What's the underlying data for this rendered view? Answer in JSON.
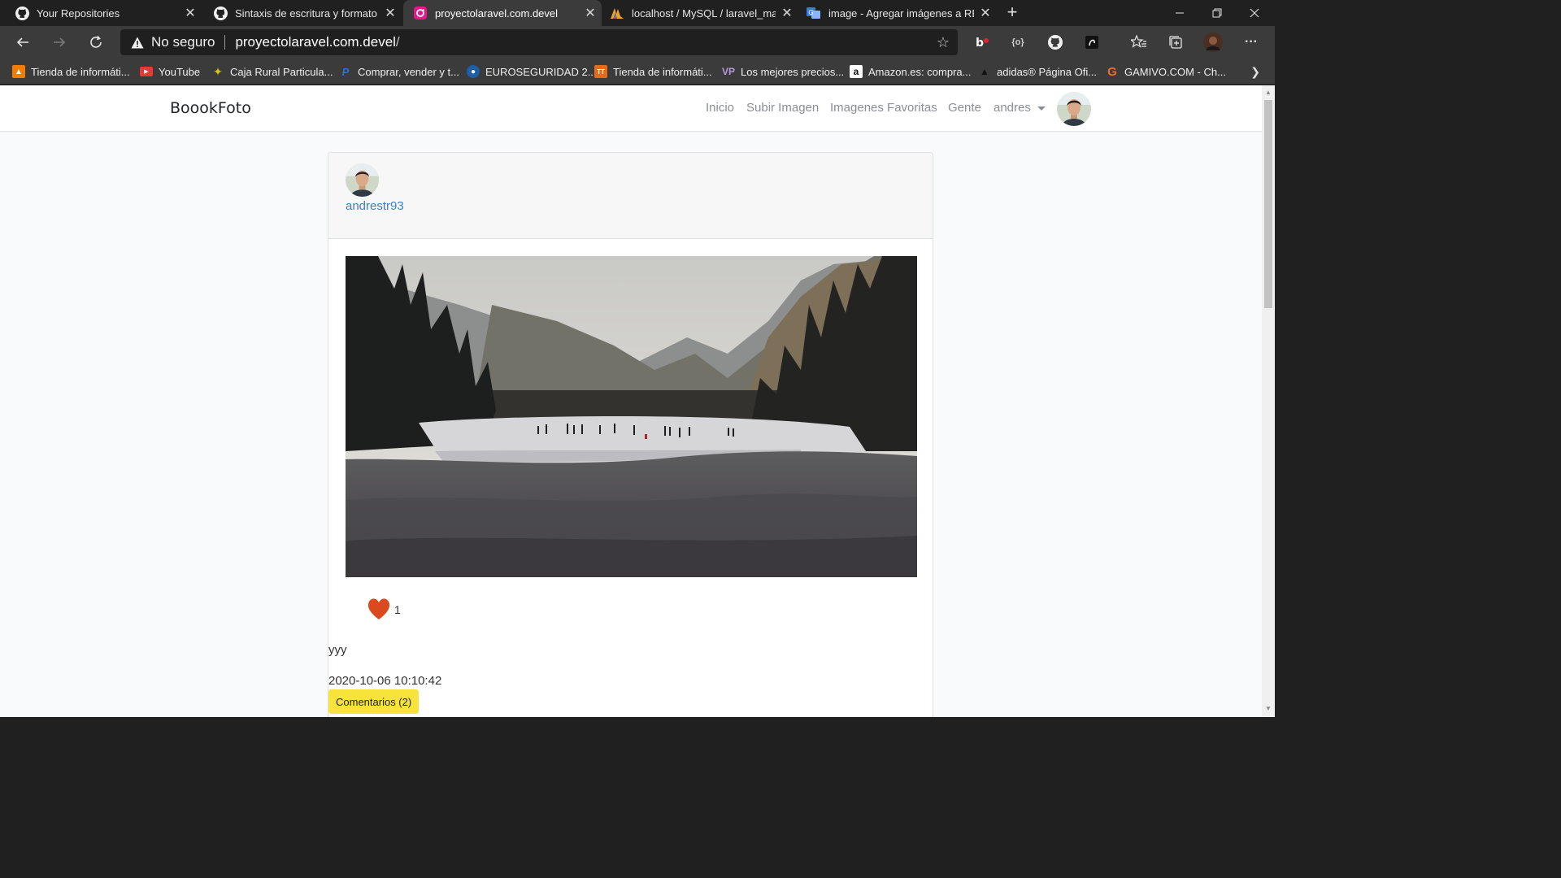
{
  "tabs": [
    {
      "title": "Your Repositories",
      "icon": "github-icon"
    },
    {
      "title": "Sintaxis de escritura y formato b",
      "icon": "github-icon"
    },
    {
      "title": "proyectolaravel.com.devel",
      "icon": "laravel-icon",
      "active": true
    },
    {
      "title": "localhost / MySQL / laravel_mast",
      "icon": "phpmyadmin-icon"
    },
    {
      "title": "image - Agregar imágenes a REA",
      "icon": "translate-icon"
    }
  ],
  "address_bar": {
    "security_label": "No seguro",
    "host": "proyectolaravel.com.devel",
    "path": "/"
  },
  "bookmarks": [
    {
      "label": "Tienda de informáti...",
      "color": "#f57c00"
    },
    {
      "label": "YouTube",
      "color": "#e53935"
    },
    {
      "label": "Caja Rural Particula...",
      "color": "#c8b400"
    },
    {
      "label": "Comprar, vender y t...",
      "color": "#1e5bd6"
    },
    {
      "label": "EUROSEGURIDAD 2...",
      "color": "#1f5fa8"
    },
    {
      "label": "Tienda de informáti...",
      "color": "#e56a1a"
    },
    {
      "label": "Los mejores precios...",
      "color": "#7a5cd0"
    },
    {
      "label": "Amazon.es: compra...",
      "color": "#ffffff"
    },
    {
      "label": "adidas® Página Ofi...",
      "color": "#1a1a1a"
    },
    {
      "label": "GAMIVO.COM - Ch...",
      "color": "#f36b21"
    }
  ],
  "site": {
    "brand": "BoookFoto",
    "nav": [
      "Inicio",
      "Subir Imagen",
      "Imagenes Favoritas",
      "Gente"
    ],
    "user_menu": "andres"
  },
  "post": {
    "username": "andrestr93",
    "likes": "1",
    "description": "yyy",
    "date": "2020-10-06 10:10:42",
    "comments_label": "Comentarios (2)"
  },
  "colors": {
    "accent_link": "#3b82c4",
    "comments_button": "#f8e33a",
    "like_heart": "#d94a1e"
  }
}
